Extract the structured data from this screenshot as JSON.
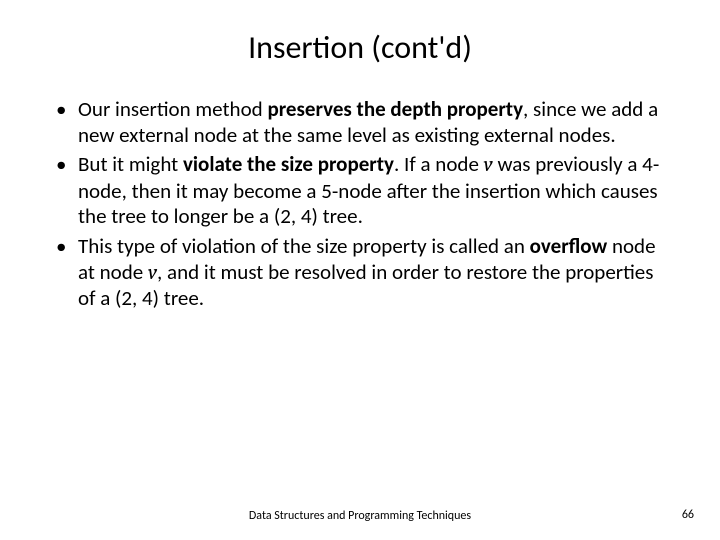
{
  "title": "Insertion (cont'd)",
  "bullets": [
    {
      "pre": "Our insertion method ",
      "bold": "preserves the depth property",
      "post": ", since we add a new external node at the same level as existing external nodes."
    },
    {
      "pre": "But it might ",
      "bold": "violate the size property",
      "post1": ". If a node ",
      "var1": "v",
      "post2": " was previously a 4-node, then it may become a 5-node after the insertion which causes the tree to longer be a (2, 4) tree."
    },
    {
      "pre": "This type of violation of the size property is called an ",
      "bold": "overflow",
      "post1": " node at node ",
      "var1": "v",
      "post2": ", and it must be resolved in order to restore the properties of a (2, 4) tree."
    }
  ],
  "footer": "Data Structures and Programming Techniques",
  "page": "66"
}
